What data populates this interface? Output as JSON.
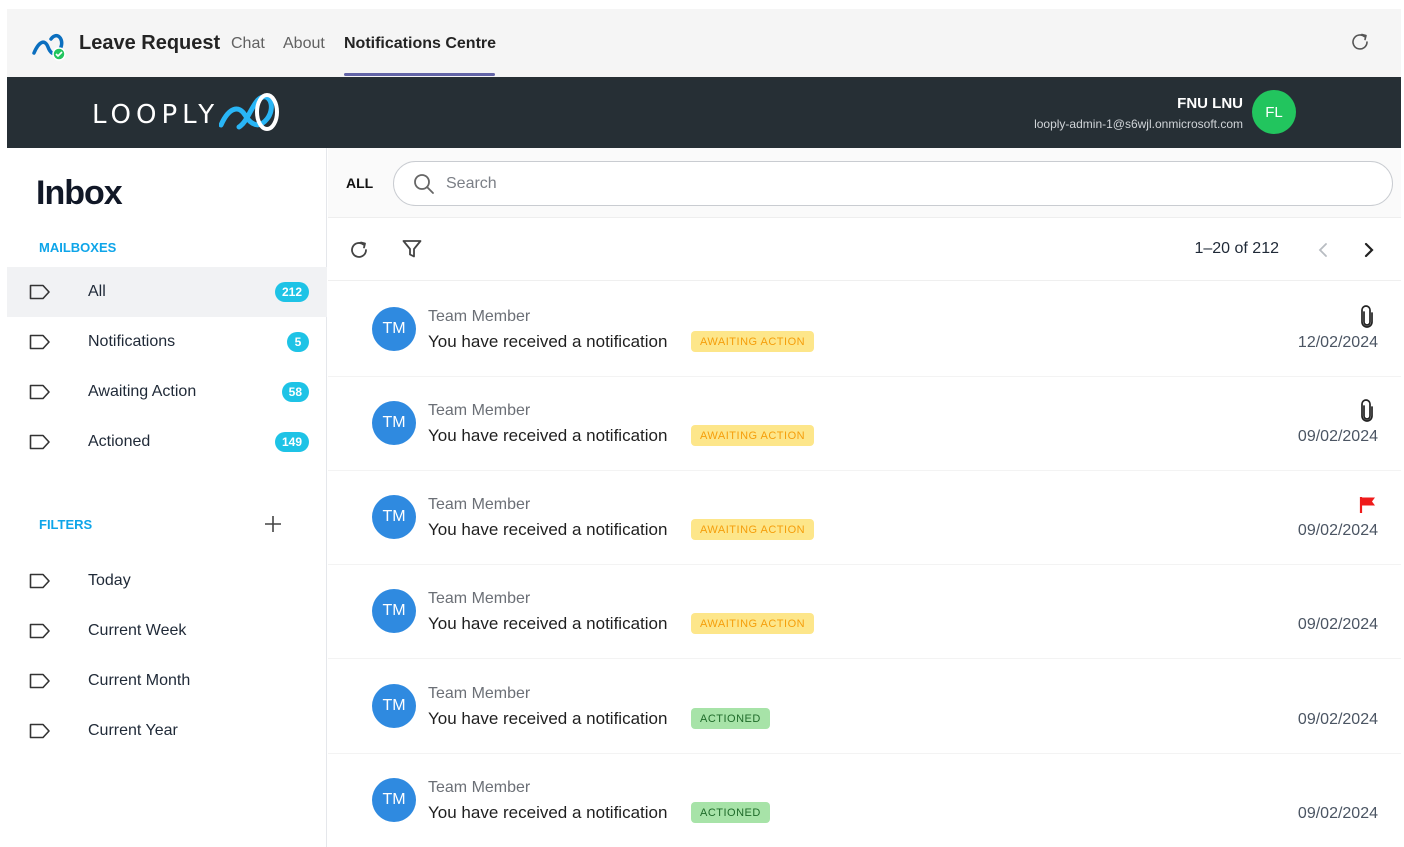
{
  "topbar": {
    "app_name": "Leave Request",
    "tabs": [
      {
        "label": "Chat"
      },
      {
        "label": "About"
      },
      {
        "label": "Notifications Centre",
        "active": true
      }
    ]
  },
  "brand": {
    "logo_text": "LOOPLY",
    "user_name": "FNU LNU",
    "user_email": "looply-admin-1@s6wjl.onmicrosoft.com",
    "user_initials": "FL"
  },
  "sidebar": {
    "title": "Inbox",
    "mailboxes_label": "MAILBOXES",
    "mailboxes": [
      {
        "label": "All",
        "count": "212",
        "selected": true
      },
      {
        "label": "Notifications",
        "count": "5"
      },
      {
        "label": "Awaiting Action",
        "count": "58"
      },
      {
        "label": "Actioned",
        "count": "149"
      }
    ],
    "filters_label": "FILTERS",
    "filters": [
      {
        "label": "Today"
      },
      {
        "label": "Current Week"
      },
      {
        "label": "Current Month"
      },
      {
        "label": "Current Year"
      }
    ]
  },
  "main": {
    "scope_label": "ALL",
    "search_placeholder": "Search",
    "pager": "1–20 of 212",
    "messages": [
      {
        "initials": "TM",
        "sender": "Team Member",
        "subject": "You have received a notification",
        "status": "AWAITING ACTION",
        "date": "12/02/2024",
        "icon": "paperclip-icon"
      },
      {
        "initials": "TM",
        "sender": "Team Member",
        "subject": "You have received a notification",
        "status": "AWAITING ACTION",
        "date": "09/02/2024",
        "icon": "paperclip-icon"
      },
      {
        "initials": "TM",
        "sender": "Team Member",
        "subject": "You have received a notification",
        "status": "AWAITING ACTION",
        "date": "09/02/2024",
        "icon": "flag-icon"
      },
      {
        "initials": "TM",
        "sender": "Team Member",
        "subject": "You have received a notification",
        "status": "AWAITING ACTION",
        "date": "09/02/2024"
      },
      {
        "initials": "TM",
        "sender": "Team Member",
        "subject": "You have received a notification",
        "status": "ACTIONED",
        "date": "09/02/2024"
      },
      {
        "initials": "TM",
        "sender": "Team Member",
        "subject": "You have received a notification",
        "status": "ACTIONED",
        "date": "09/02/2024"
      }
    ]
  },
  "colors": {
    "accent_tab": "#6264a7",
    "brand_bar": "#262f35",
    "mailbox_label": "#0ea5e9",
    "count_badge": "#1ec3e6",
    "user_avatar": "#22c55e",
    "message_avatar": "#2f8ae0",
    "awaiting_badge_bg": "#fde68a",
    "actioned_badge_bg": "#a7e3a8",
    "flag": "#ef1b1b"
  }
}
